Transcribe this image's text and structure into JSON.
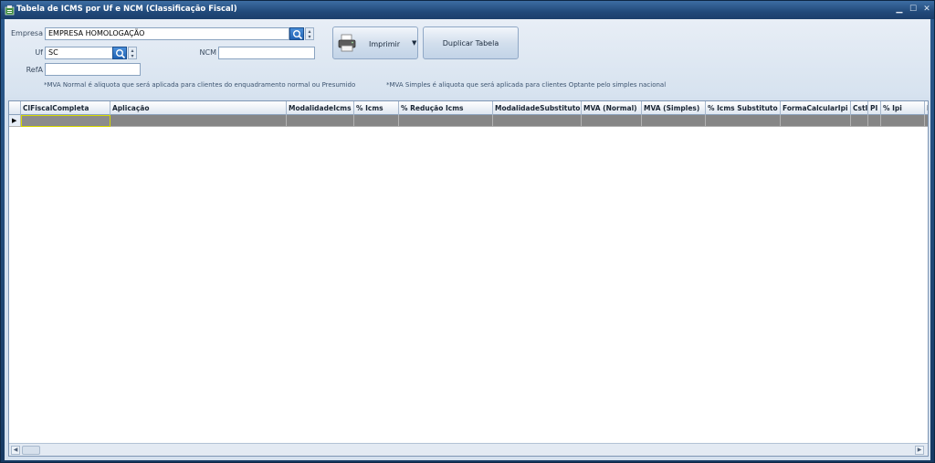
{
  "window": {
    "title": "Tabela de ICMS por Uf e NCM (Classificação Fiscal)"
  },
  "form": {
    "empresa_label": "Empresa",
    "empresa_value": "EMPRESA HOMOLOGAÇÃO",
    "uf_label": "Uf",
    "uf_value": "SC",
    "ncm_label": "NCM",
    "ncm_value": "",
    "refa_label": "RefA",
    "refa_value": "",
    "imprimir_label": "Imprimir",
    "duplicar_label": "Duplicar Tabela",
    "hint_normal": "*MVA Normal é aliquota que será aplicada para clientes do enquadramento normal ou Presumido",
    "hint_simples": "*MVA Simples é aliquota que será aplicada para clientes Optante pelo simples nacional"
  },
  "grid": {
    "columns": [
      "ClFiscalCompleta",
      "Aplicação",
      "ModalidadeIcms",
      "% Icms",
      "% Redução Icms",
      "ModalidadeSubstituto",
      "MVA (Normal)",
      "MVA (Simples)",
      "% Icms Substituto",
      "FormaCalcularIpi",
      "CstI",
      "PI",
      "% Ipi",
      "I"
    ]
  },
  "colors": {
    "titlebar": "#21497a",
    "row_selected": "#868686",
    "focus_cell": "#d9d900"
  }
}
